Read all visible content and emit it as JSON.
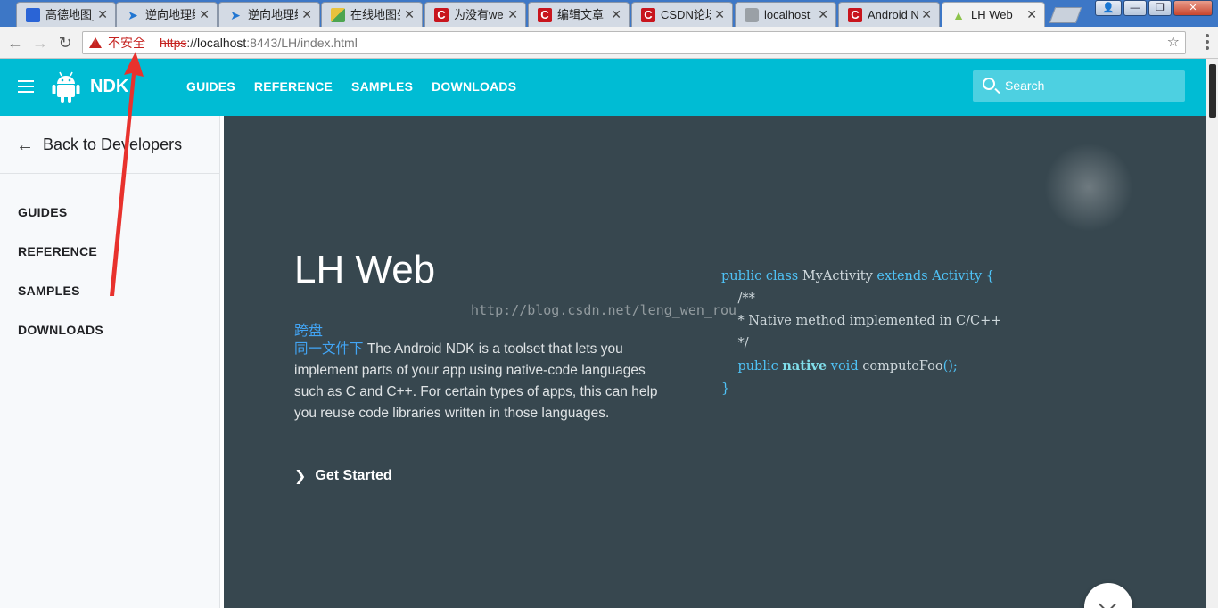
{
  "browser": {
    "tabs": [
      {
        "title": "高德地图_",
        "icon": "paw-icon"
      },
      {
        "title": "逆向地理编",
        "icon": "plane-icon"
      },
      {
        "title": "逆向地理编",
        "icon": "plane-icon"
      },
      {
        "title": "在线地图坐",
        "icon": "map-icon"
      },
      {
        "title": "为没有we",
        "icon": "csdn-icon"
      },
      {
        "title": "编辑文章 -",
        "icon": "csdn-icon"
      },
      {
        "title": "CSDN论坛",
        "icon": "csdn-icon"
      },
      {
        "title": "localhost",
        "icon": "globe-icon"
      },
      {
        "title": "Android N",
        "icon": "csdn-icon"
      },
      {
        "title": "LH Web",
        "icon": "android-icon",
        "active": true
      }
    ],
    "close_glyph": "✕",
    "csdn_letter": "C",
    "security_label": "不安全",
    "url_scheme": "https",
    "url_sep": "://",
    "url_host": "localhost",
    "url_path": ":8443/LH/index.html",
    "window_buttons": {
      "minimize": "—",
      "maximize": "❐",
      "close": "✕"
    }
  },
  "header": {
    "brand": "NDK",
    "nav": [
      "GUIDES",
      "REFERENCE",
      "SAMPLES",
      "DOWNLOADS"
    ],
    "search_label": "Search"
  },
  "sidebar": {
    "back_label": "Back to Developers",
    "items": [
      "GUIDES",
      "REFERENCE",
      "SAMPLES",
      "DOWNLOADS"
    ]
  },
  "hero": {
    "title": "LH Web",
    "link1": "跨盘",
    "link2": "同一文件下",
    "description": " The Android NDK is a toolset that lets you implement parts of your app using native-code languages such as C and C++. For certain types of apps, this can help you reuse code libraries written in those languages.",
    "cta": "Get Started",
    "watermark": "http://blog.csdn.net/leng_wen_rou"
  },
  "code": {
    "line1": {
      "kw1": "public",
      "kw2": "class",
      "name": "MyActivity",
      "kw3": "extends",
      "base": "Activity",
      "brace": "{"
    },
    "line2": "/**",
    "line3": "* Native method implemented in C/C++",
    "line4": "*/",
    "line5": {
      "kw1": "public",
      "kw2": "native",
      "kw3": "void",
      "name": "computeFoo",
      "tail": "();"
    },
    "line6": "}"
  },
  "colors": {
    "header": "#00bcd4",
    "hero_bg": "#37474f",
    "link": "#42a5f5",
    "sidebar_bg": "#f7f9fb",
    "annotation_arrow": "#e8322d"
  }
}
